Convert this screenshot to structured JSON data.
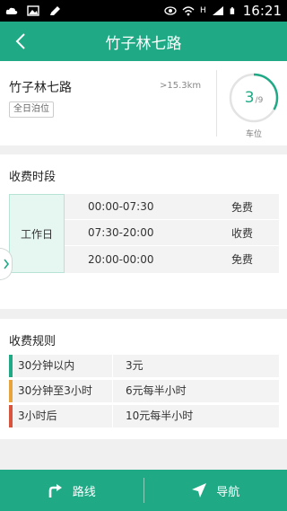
{
  "status_bar": {
    "time": "16:21",
    "signal_letter": "H"
  },
  "header": {
    "title": "竹子林七路"
  },
  "lot": {
    "name": "竹子林七路",
    "distance": ">15.3km",
    "tag": "全日泊位",
    "available": "3",
    "total": "/9",
    "available_fraction": 0.333,
    "spaces_label": "车位"
  },
  "fee_periods": {
    "title": "收费时段",
    "day_type": "工作日",
    "rows": [
      {
        "time": "00:00-07:30",
        "status": "免费"
      },
      {
        "time": "07:30-20:00",
        "status": "收费"
      },
      {
        "time": "20:00-00:00",
        "status": "免费"
      }
    ]
  },
  "fee_rules": {
    "title": "收费规则",
    "rows": [
      {
        "duration": "30分钟以内",
        "price": "3元",
        "color": "#1faa85"
      },
      {
        "duration": "30分钟至3小时",
        "price": "6元每半小时",
        "color": "#e8a33a"
      },
      {
        "duration": "3小时后",
        "price": "10元每半小时",
        "color": "#d9543c"
      }
    ]
  },
  "bottom_bar": {
    "route_label": "路线",
    "navigate_label": "导航"
  },
  "colors": {
    "primary": "#1faa85"
  }
}
